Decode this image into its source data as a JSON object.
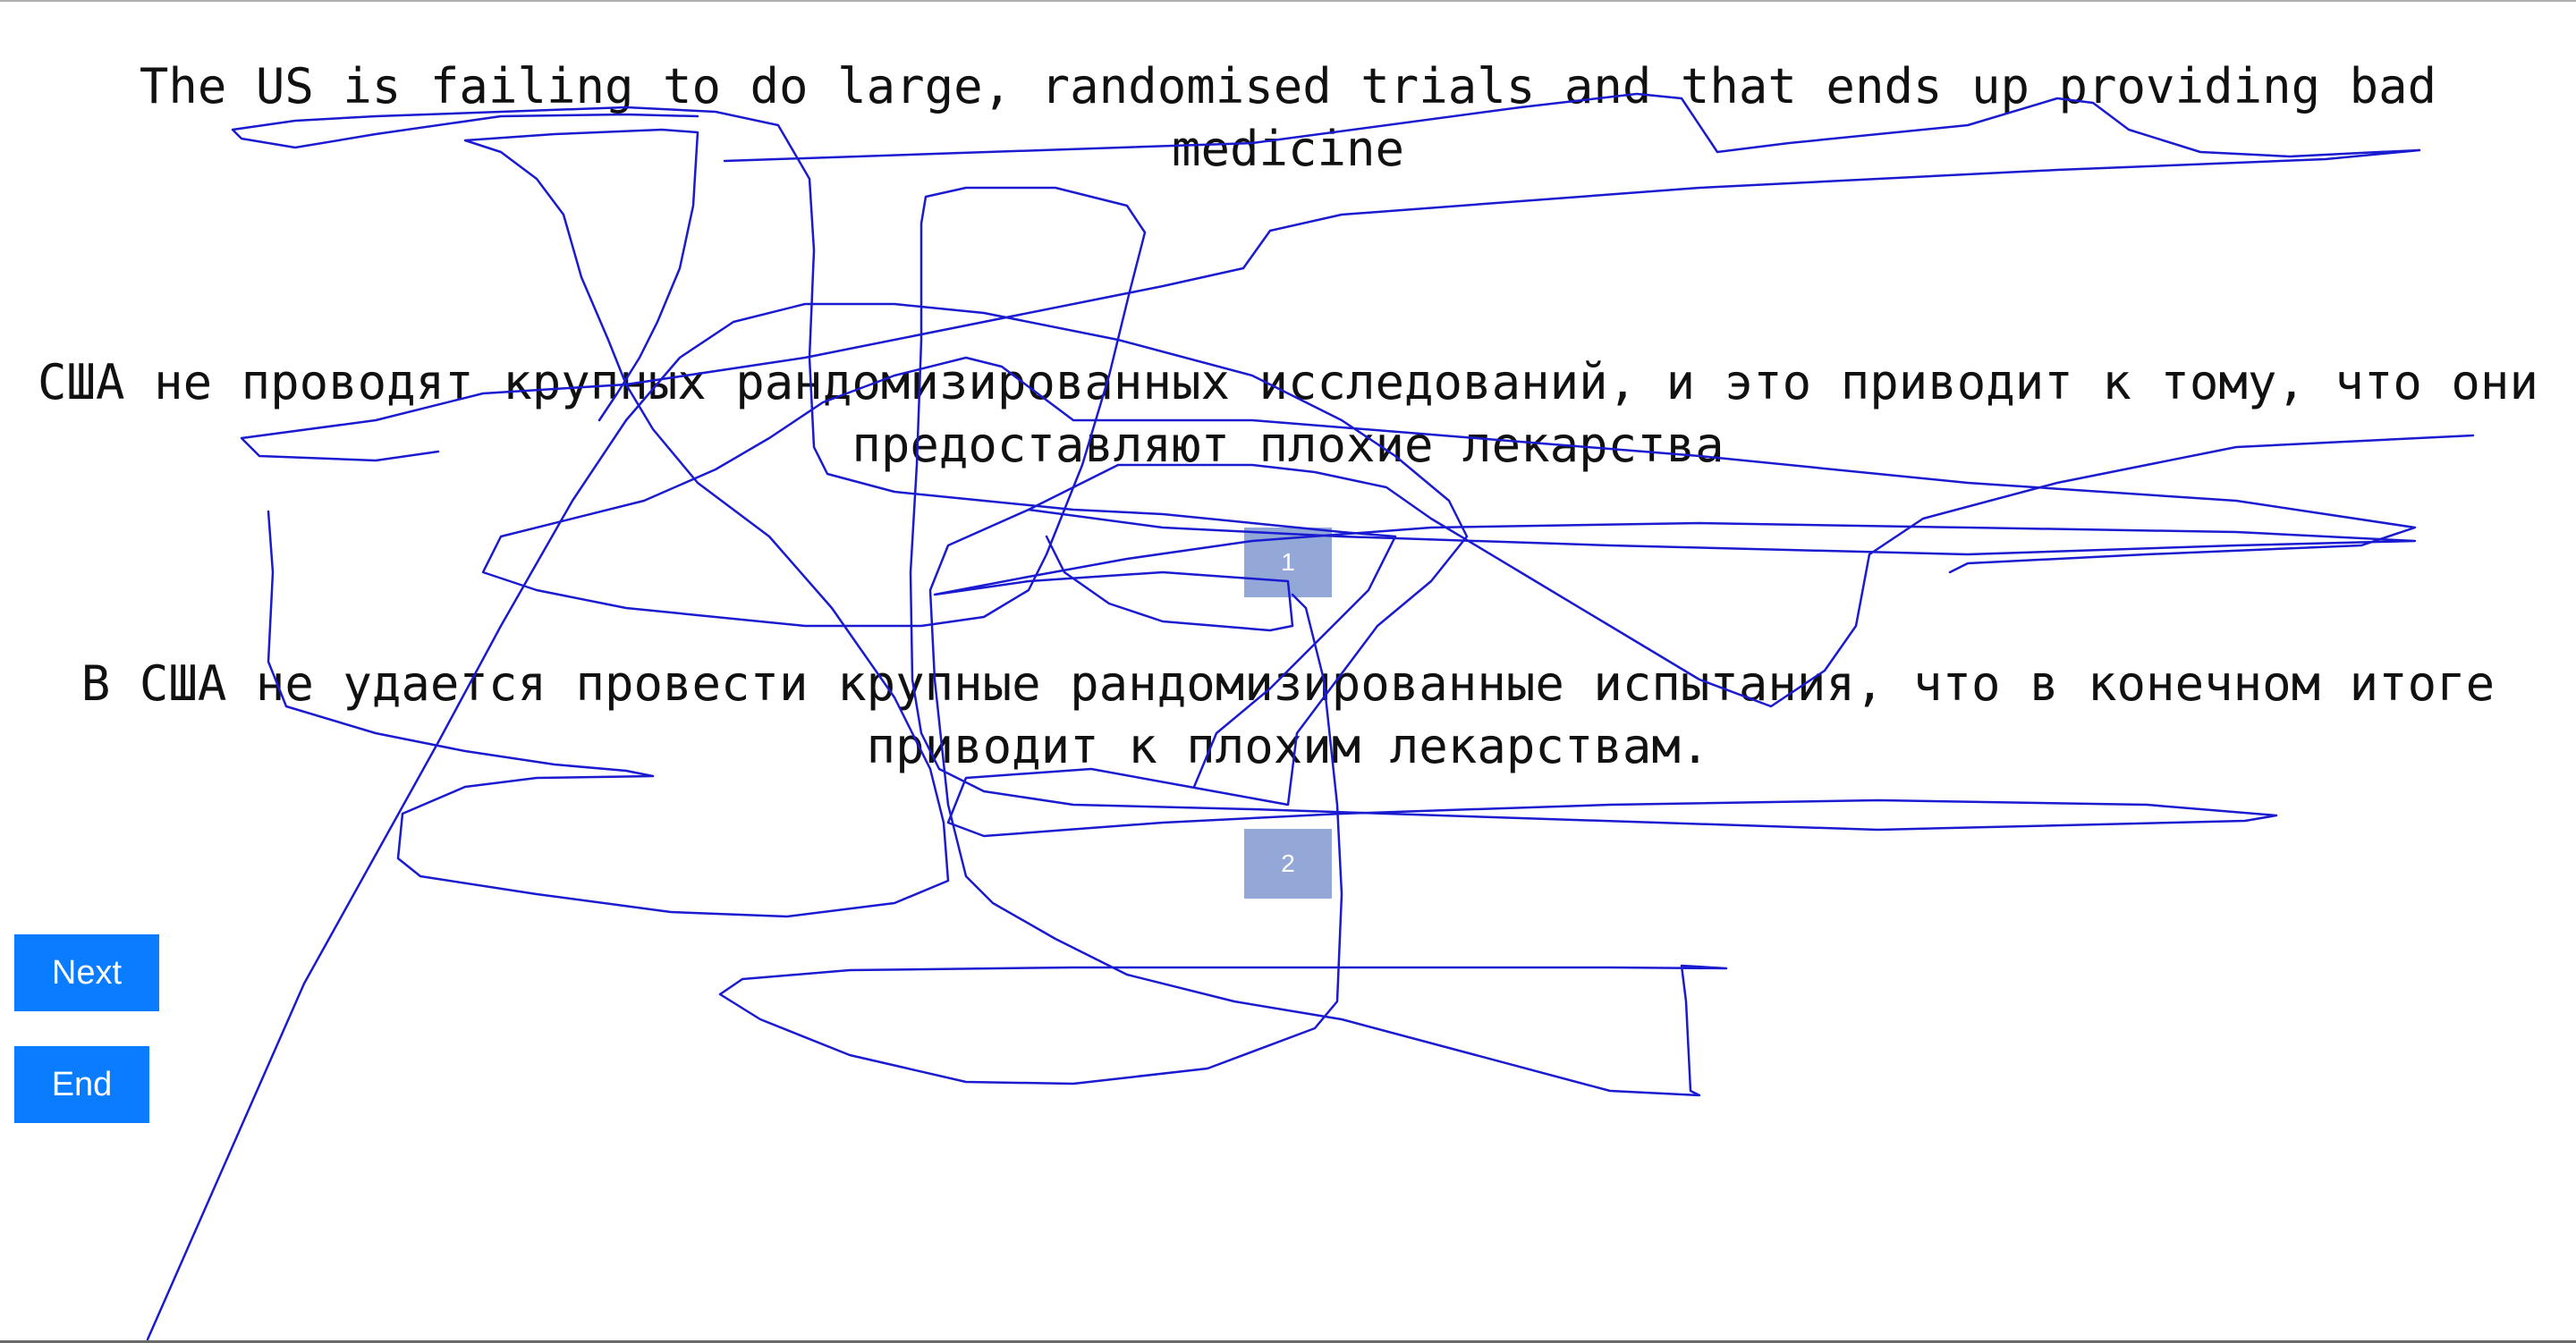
{
  "source_sentence": "The US is failing to do large, randomised trials and that ends up providing bad medicine",
  "translations": [
    {
      "text": "США не проводят крупных рандомизированных исследований, и это приводит к тому, что они предоставляют плохие лекарства",
      "rank_label": "1"
    },
    {
      "text": "В США не удается провести крупные рандомизированные испытания, что в конечном итоге приводит к плохим лекарствам.",
      "rank_label": "2"
    }
  ],
  "buttons": {
    "next_label": "Next",
    "end_label": "End"
  },
  "colors": {
    "button_bg": "#0a7cff",
    "rank_box_bg": "#94a8d8",
    "pen_stroke": "#1a1ad0"
  },
  "annotation": {
    "type": "freehand-pen-stroke"
  }
}
